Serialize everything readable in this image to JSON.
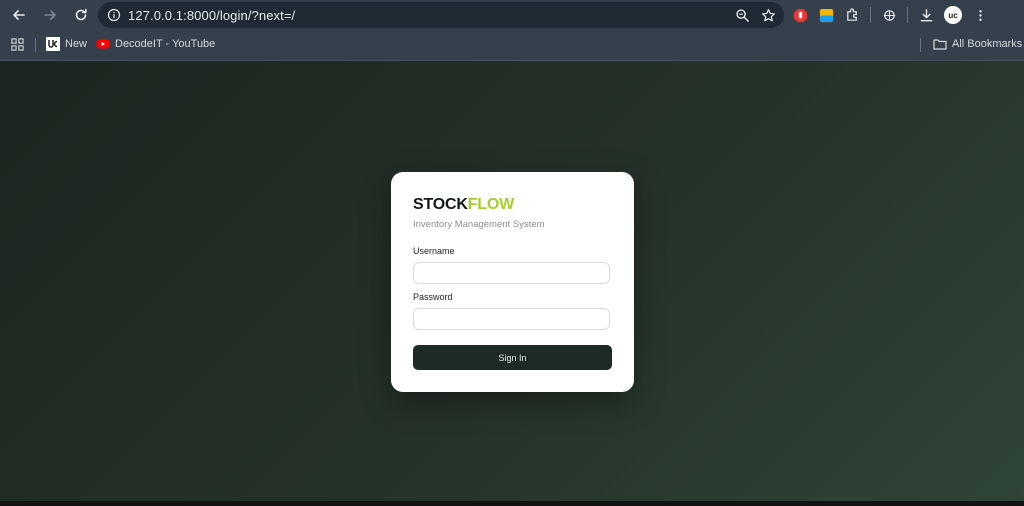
{
  "browser": {
    "url": "127.0.0.1:8000/login/?next=/",
    "profile_initials": "uc",
    "bookmarks": [
      {
        "label": "New"
      },
      {
        "label": "DecodeIT - YouTube"
      }
    ],
    "all_bookmarks_label": "All Bookmarks"
  },
  "login": {
    "brand_part1": "STOCK",
    "brand_part2": "FLOW",
    "subtitle": "Inventory Management System",
    "username_label": "Username",
    "username_value": "",
    "password_label": "Password",
    "password_value": "",
    "submit_label": "Sign In"
  },
  "colors": {
    "brand_dark": "#111a15",
    "brand_accent": "#a4cf2a",
    "button_bg": "#1e2b25",
    "page_bg_start": "#1c251f",
    "page_bg_end": "#2f4537"
  }
}
